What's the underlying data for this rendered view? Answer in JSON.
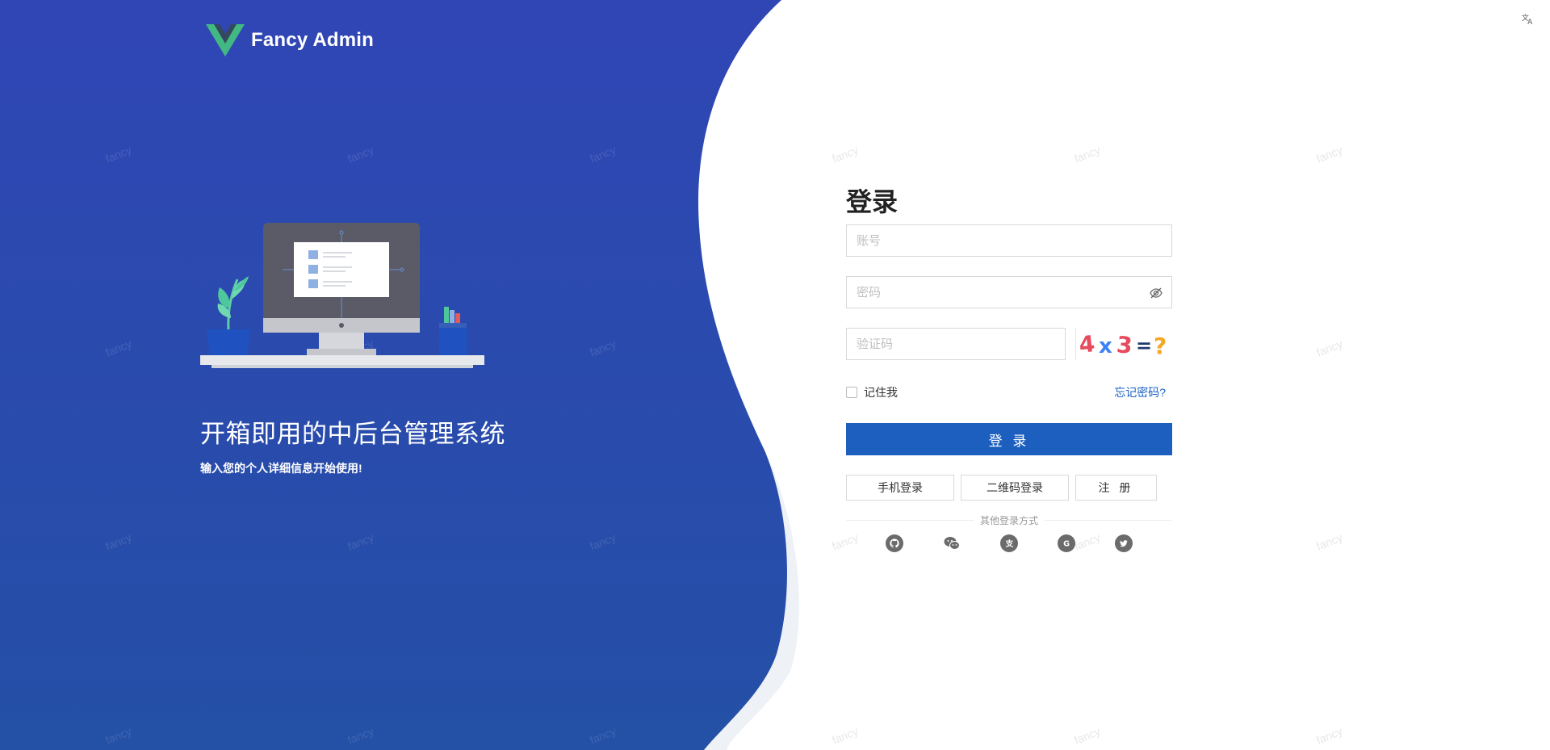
{
  "brand": {
    "name": "Fancy Admin",
    "logo_icon": "vue-v-logo-icon",
    "colors": {
      "blue_top": "#3046b5",
      "blue_bottom": "#2450a6",
      "logo_green": "#42b983",
      "logo_dark": "#35495e"
    }
  },
  "hero": {
    "title": "开箱即用的中后台管理系统",
    "subtitle": "输入您的个人详细信息开始使用!"
  },
  "watermark": "fancy",
  "login": {
    "title": "登录",
    "account_placeholder": "账号",
    "password_placeholder": "密码",
    "captcha_placeholder": "验证码",
    "remember_label": "记住我",
    "forgot_label": "忘记密码?",
    "submit_label": "登 录",
    "phone_login_label": "手机登录",
    "qrcode_login_label": "二维码登录",
    "register_label": "注 册",
    "other_methods_label": "其他登录方式",
    "accent_color": "#1d5fbf",
    "captcha_text": "4x3=?"
  },
  "socials": [
    "github-icon",
    "wechat-icon",
    "alipay-icon",
    "google-icon",
    "twitter-icon"
  ],
  "lang_toggle_icon": "translate-icon"
}
